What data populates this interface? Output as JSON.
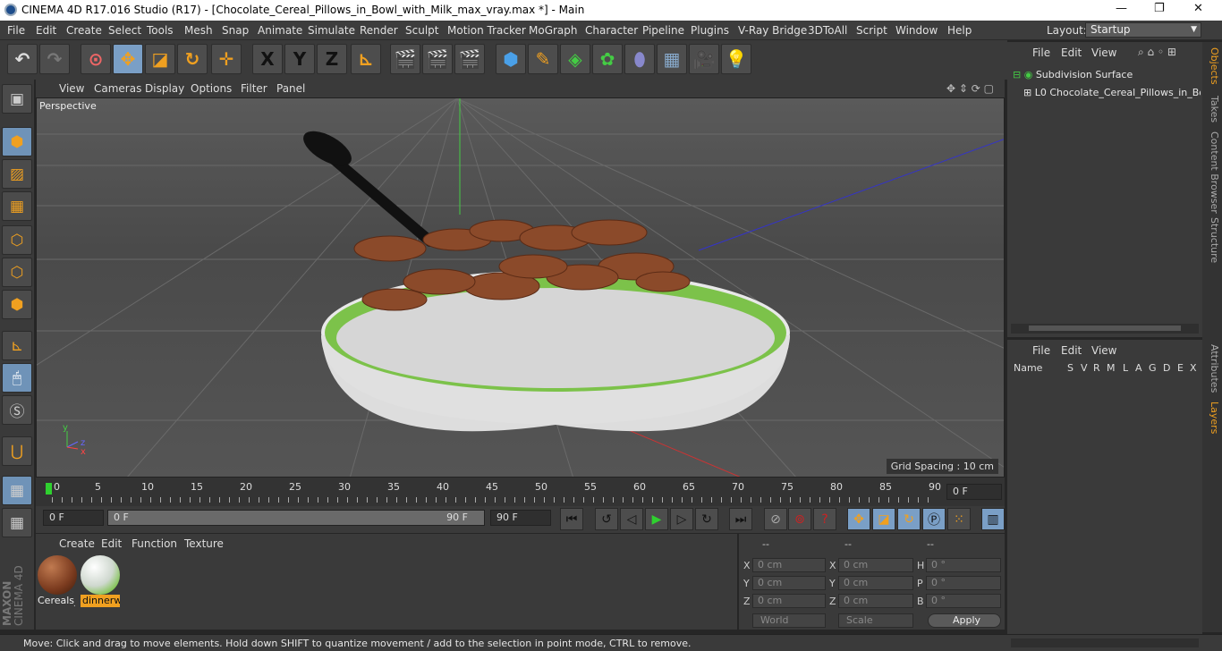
{
  "window": {
    "title": "CINEMA 4D R17.016 Studio (R17) - [Chocolate_Cereal_Pillows_in_Bowl_with_Milk_max_vray.max *] - Main"
  },
  "menubar": {
    "items": [
      "File",
      "Edit",
      "Create",
      "Select",
      "Tools",
      "Mesh",
      "Snap",
      "Animate",
      "Simulate",
      "Render",
      "Sculpt",
      "Motion Tracker",
      "MoGraph",
      "Character",
      "Pipeline",
      "Plugins",
      "V-Ray Bridge",
      "3DToAll",
      "Script",
      "Window",
      "Help"
    ],
    "layout_label": "Layout:",
    "layout_value": "Startup"
  },
  "toolbar": {
    "x_label": "X",
    "y_label": "Y",
    "z_label": "Z"
  },
  "viewport": {
    "menu": [
      "View",
      "Cameras",
      "Display",
      "Options",
      "Filter",
      "Panel"
    ],
    "label": "Perspective",
    "grid_spacing": "Grid Spacing : 10 cm"
  },
  "timeline": {
    "ticks": [
      "0",
      "5",
      "10",
      "15",
      "20",
      "25",
      "30",
      "35",
      "40",
      "45",
      "50",
      "55",
      "60",
      "65",
      "70",
      "75",
      "80",
      "85",
      "90"
    ],
    "frame_field": "0 F"
  },
  "playback": {
    "start": "0 F",
    "range_start": "0 F",
    "range_end": "90 F",
    "end": "90 F"
  },
  "materials": {
    "menu": [
      "Create",
      "Edit",
      "Function",
      "Texture"
    ],
    "items": [
      {
        "name": "Cereals_",
        "color": "#8b4a2a"
      },
      {
        "name": "dinnerw",
        "color": "#cfd8cf"
      }
    ]
  },
  "coords": {
    "headers": [
      "--",
      "--",
      "--"
    ],
    "rows": [
      {
        "a": "X",
        "a_val": "0 cm",
        "b": "X",
        "b_val": "0 cm",
        "c": "H",
        "c_val": "0 °"
      },
      {
        "a": "Y",
        "a_val": "0 cm",
        "b": "Y",
        "b_val": "0 cm",
        "c": "P",
        "c_val": "0 °"
      },
      {
        "a": "Z",
        "a_val": "0 cm",
        "b": "Z",
        "b_val": "0 cm",
        "c": "B",
        "c_val": "0 °"
      }
    ],
    "world": "World",
    "scale": "Scale",
    "apply": "Apply"
  },
  "objects": {
    "menu": [
      "File",
      "Edit",
      "View"
    ],
    "tree": [
      "Subdivision Surface",
      "Chocolate_Cereal_Pillows_in_Bow"
    ]
  },
  "attributes": {
    "menu": [
      "File",
      "Edit",
      "View"
    ],
    "columns": [
      "Name",
      "S",
      "V",
      "R",
      "M",
      "L",
      "A",
      "G",
      "D",
      "E",
      "X"
    ]
  },
  "sidetabs": [
    "Objects",
    "Takes",
    "Content Browser",
    "Structure",
    "Attributes",
    "Layers"
  ],
  "status": "Move: Click and drag to move elements. Hold down SHIFT to quantize movement / add to the selection in point mode, CTRL to remove.",
  "brand": {
    "line1": "MAXON",
    "line2": "CINEMA 4D"
  }
}
